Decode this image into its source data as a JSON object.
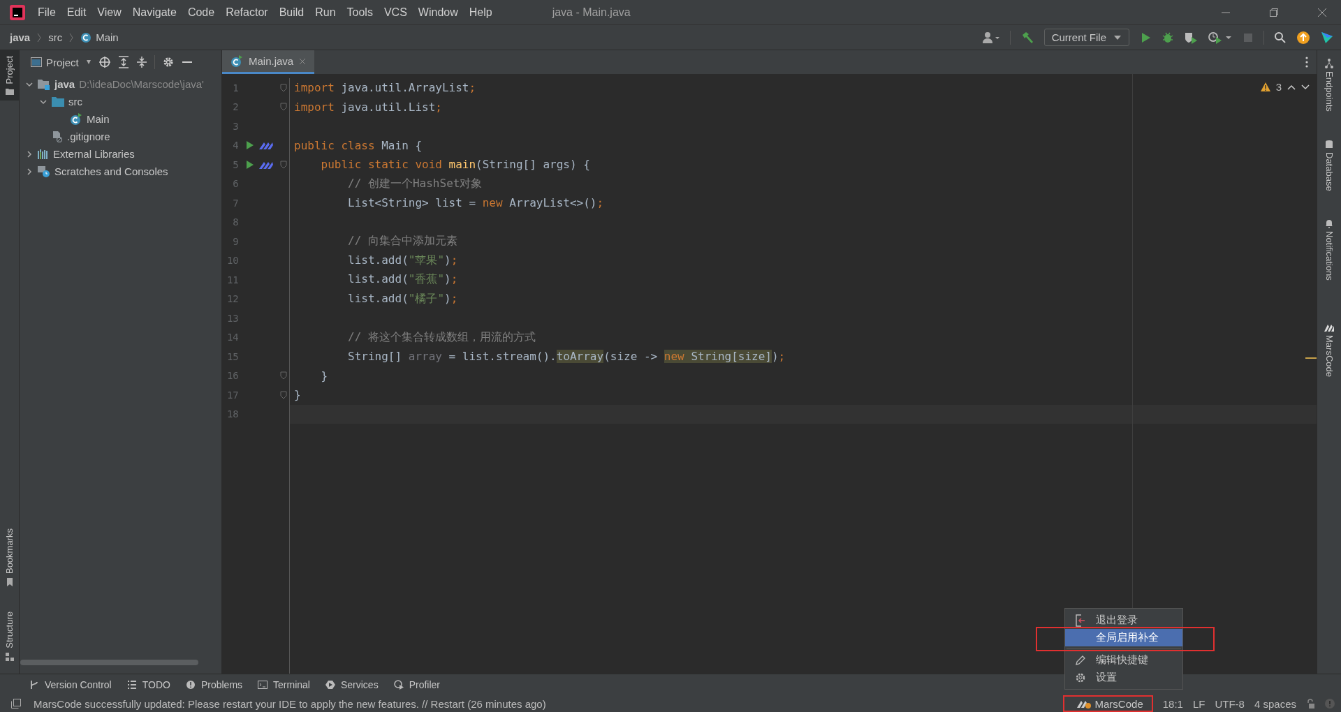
{
  "menu": [
    "File",
    "Edit",
    "View",
    "Navigate",
    "Code",
    "Refactor",
    "Build",
    "Run",
    "Tools",
    "VCS",
    "Window",
    "Help"
  ],
  "window": {
    "title": "java - Main.java"
  },
  "breadcrumbs": [
    "java",
    "src",
    "Main"
  ],
  "toolbar": {
    "run_config": "Current File"
  },
  "left_stripe": [
    {
      "label": "Project",
      "selected": true
    },
    {
      "label": "Bookmarks",
      "selected": false
    },
    {
      "label": "Structure",
      "selected": false
    }
  ],
  "right_stripe": [
    {
      "label": "Endpoints",
      "kind": "endpoints"
    },
    {
      "label": "Database",
      "kind": "database"
    },
    {
      "label": "Notifications",
      "kind": "bell"
    },
    {
      "label": "MarsCode",
      "kind": "marscode"
    }
  ],
  "project_panel": {
    "title": "Project",
    "tree": [
      {
        "label": "java",
        "hint": "D:\\ideaDoc\\Marscode\\java'",
        "kind": "module",
        "expanded": true,
        "children": [
          {
            "label": "src",
            "kind": "folder",
            "expanded": true,
            "children": [
              {
                "label": "Main",
                "kind": "class"
              }
            ]
          },
          {
            "label": ".gitignore",
            "kind": "file"
          }
        ]
      },
      {
        "label": "External Libraries",
        "kind": "libs",
        "expanded": false
      },
      {
        "label": "Scratches and Consoles",
        "kind": "scratch",
        "expanded": false
      }
    ]
  },
  "editor": {
    "tabs": [
      {
        "label": "Main.java",
        "selected": true
      }
    ],
    "warnings": "3",
    "lines": [
      {
        "num": "1",
        "fold": true,
        "tokens": [
          {
            "t": "import ",
            "kind": "kw"
          },
          {
            "t": "java.util.ArrayList",
            "kind": "plain"
          },
          {
            "t": ";",
            "kind": "kw"
          }
        ]
      },
      {
        "num": "2",
        "fold": true,
        "tokens": [
          {
            "t": "import ",
            "kind": "kw"
          },
          {
            "t": "java.util.List",
            "kind": "plain"
          },
          {
            "t": ";",
            "kind": "kw"
          }
        ]
      },
      {
        "num": "3"
      },
      {
        "num": "4",
        "run": true,
        "tokens": [
          {
            "t": "public class ",
            "kind": "kw"
          },
          {
            "t": "Main {",
            "kind": "plain"
          }
        ]
      },
      {
        "num": "5",
        "run": true,
        "fold": true,
        "tokens": [
          {
            "t": "    public static void ",
            "kind": "kw"
          },
          {
            "t": "main",
            "kind": "method"
          },
          {
            "t": "(String[] args) {",
            "kind": "plain"
          }
        ]
      },
      {
        "num": "6",
        "tokens": [
          {
            "t": "        // 创建一个HashSet对象",
            "kind": "comment"
          }
        ]
      },
      {
        "num": "7",
        "tokens": [
          {
            "t": "        List<String> list = ",
            "kind": "plain"
          },
          {
            "t": "new ",
            "kind": "kw"
          },
          {
            "t": "ArrayList<>()",
            "kind": "plain"
          },
          {
            "t": ";",
            "kind": "kw"
          }
        ]
      },
      {
        "num": "8"
      },
      {
        "num": "9",
        "tokens": [
          {
            "t": "        // 向集合中添加元素",
            "kind": "comment"
          }
        ]
      },
      {
        "num": "10",
        "tokens": [
          {
            "t": "        list.add(",
            "kind": "plain"
          },
          {
            "t": "\"苹果\"",
            "kind": "str"
          },
          {
            "t": ")",
            "kind": "plain"
          },
          {
            "t": ";",
            "kind": "kw"
          }
        ]
      },
      {
        "num": "11",
        "tokens": [
          {
            "t": "        list.add(",
            "kind": "plain"
          },
          {
            "t": "\"香蕉\"",
            "kind": "str"
          },
          {
            "t": ")",
            "kind": "plain"
          },
          {
            "t": ";",
            "kind": "kw"
          }
        ]
      },
      {
        "num": "12",
        "tokens": [
          {
            "t": "        list.add(",
            "kind": "plain"
          },
          {
            "t": "\"橘子\"",
            "kind": "str"
          },
          {
            "t": ")",
            "kind": "plain"
          },
          {
            "t": ";",
            "kind": "kw"
          }
        ]
      },
      {
        "num": "13"
      },
      {
        "num": "14",
        "tokens": [
          {
            "t": "        // 将这个集合转成数组，用流的方式",
            "kind": "comment"
          }
        ]
      },
      {
        "num": "15",
        "tokens": [
          {
            "t": "        String[] ",
            "kind": "plain"
          },
          {
            "t": "array",
            "kind": "muted"
          },
          {
            "t": " = list.stream().",
            "kind": "plain"
          },
          {
            "t": "toArray",
            "kind": "hl"
          },
          {
            "t": "(size -> ",
            "kind": "plain"
          },
          {
            "t": "new ",
            "kind": "hlkw"
          },
          {
            "t": "String[size]",
            "kind": "hl"
          },
          {
            "t": ")",
            "kind": "plain"
          },
          {
            "t": ";",
            "kind": "kw"
          }
        ]
      },
      {
        "num": "16",
        "fold": true,
        "tokens": [
          {
            "t": "    }",
            "kind": "plain"
          }
        ]
      },
      {
        "num": "17",
        "fold": true,
        "tokens": [
          {
            "t": "}",
            "kind": "plain"
          }
        ]
      },
      {
        "num": "18",
        "current": true
      }
    ]
  },
  "popup_menu": [
    {
      "label": "退出登录",
      "kind": "logout",
      "selected": false
    },
    {
      "label": "全局启用补全",
      "kind": "none",
      "selected": true,
      "annotated": true
    },
    {
      "label": "编辑快捷键",
      "kind": "pencil",
      "selected": false
    },
    {
      "label": "设置",
      "kind": "gear",
      "selected": false
    }
  ],
  "tool_windows": [
    {
      "label": "Version Control",
      "kind": "vcs"
    },
    {
      "label": "TODO",
      "kind": "list"
    },
    {
      "label": "Problems",
      "kind": "problems"
    },
    {
      "label": "Terminal",
      "kind": "terminal"
    },
    {
      "label": "Services",
      "kind": "services"
    },
    {
      "label": "Profiler",
      "kind": "profiler"
    }
  ],
  "status_bar": {
    "message": "MarsCode successfully updated: Please restart your IDE to apply the new features. // Restart (26 minutes ago)",
    "plugin": {
      "label": "MarsCode",
      "annotated": true
    },
    "items": [
      "18:1",
      "LF",
      "UTF-8",
      "4 spaces"
    ]
  }
}
